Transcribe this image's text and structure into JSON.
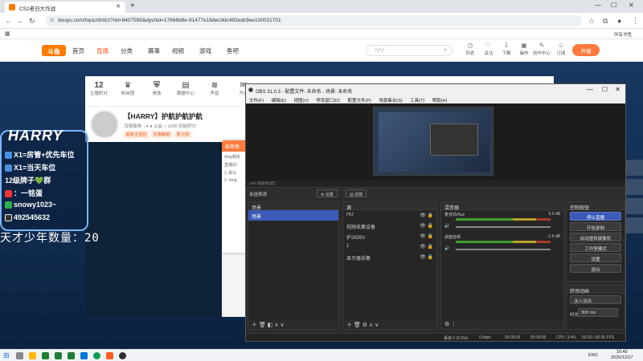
{
  "browser": {
    "tab_title": "CS2老日大作战",
    "new_tab": "+",
    "url": "douyu.com/topic/drdzz?rid=9407595&dyshid=17668d8e-91477e16dec9dc492edc9ee100021701",
    "all_bookmarks": "所有书签"
  },
  "site": {
    "logo": "斗鱼",
    "nav": [
      "首页",
      "直播",
      "分类",
      "赛事",
      "视频",
      "游戏",
      "鱼吧"
    ],
    "search_placeholder": "zyfyf",
    "toolbar_icons": [
      "历史",
      "关注",
      "下载",
      "操作",
      "创作中心",
      "订阅"
    ],
    "kaibo": "开播",
    "room_top": [
      {
        "big": "12",
        "label": "主播积分"
      },
      {
        "big": "",
        "label": "粉丝团"
      },
      {
        "big": "",
        "label": "贵族"
      },
      {
        "big": "",
        "label": "数据中心"
      },
      {
        "big": "",
        "label": "声音"
      },
      {
        "big": "",
        "label": "开通"
      }
    ],
    "streamer": {
      "title": "【HARRY】护航护航护航",
      "meta": "乌鸦咖啡 ♀4  ● 公会  ○ 1000 初始积分",
      "tags": [
        "超级主任回",
        "礼物解锁",
        "新上线"
      ]
    },
    "popup_title": "推荐榜",
    "popup_lines": [
      "rbng相关",
      "直播间：",
      "1. 默认",
      "2. rbng"
    ]
  },
  "overlay": {
    "brand": "HARRY",
    "lines": [
      "X1=房管+优先车位",
      "X1=当天车位",
      "12级牌子💚群",
      "：一铭蛋",
      "snowy1023~",
      "492545632"
    ],
    "count_label": "天才少年数量：20"
  },
  "obs": {
    "title": "OBS 31.0.3 - 配置文件: 未命名 - 场景: 未命名",
    "menu": [
      "文件(F)",
      "编辑(E)",
      "视图(V)",
      "停靠窗口(D)",
      "配置文件(P)",
      "场景集合(S)",
      "工具(T)",
      "帮助(H)"
    ],
    "zoom_text": "18%   缩放预览区",
    "no_source": "未选择源",
    "props_btn": "⚙ 设置",
    "filters_btn": "▤ 滤镜",
    "scenes_title": "场景",
    "scenes": [
      "场景"
    ],
    "sources_title": "源",
    "sources": [
      "HU",
      "视频采集设备",
      "护2839V",
      "1",
      "显示器采集"
    ],
    "mixer_title": "混音器",
    "mixer": [
      {
        "name": "麦克风/Aux",
        "db": "0.0 dB"
      },
      {
        "name": "桌面音频",
        "db": "-1.6 dB"
      }
    ],
    "meter_scale": "-60 -55 -50 -45 -40 -35 -30 -25 -20 -15 -10 -5 0",
    "controls_title": "控制按钮",
    "controls": [
      "停止直播",
      "开始录制",
      "启动虚拟摄像机",
      "工作室模式",
      "设置",
      "退出"
    ],
    "transitions_title": "转场动画",
    "transition_type": "淡入淡出",
    "duration_label": "时长",
    "duration_value": "300 ms",
    "status": {
      "dropped": "丢帧 0 (0.0%)",
      "kbps": "0 kbps",
      "stream_time": "00:00:00",
      "rec_time": "00:00:00",
      "cpu": "CPU: 3.4%",
      "fps": "60.00 / 60.00 FPS"
    }
  },
  "taskbar": {
    "lang": "ENG",
    "time": "16:45",
    "date": "2025/12/17"
  }
}
